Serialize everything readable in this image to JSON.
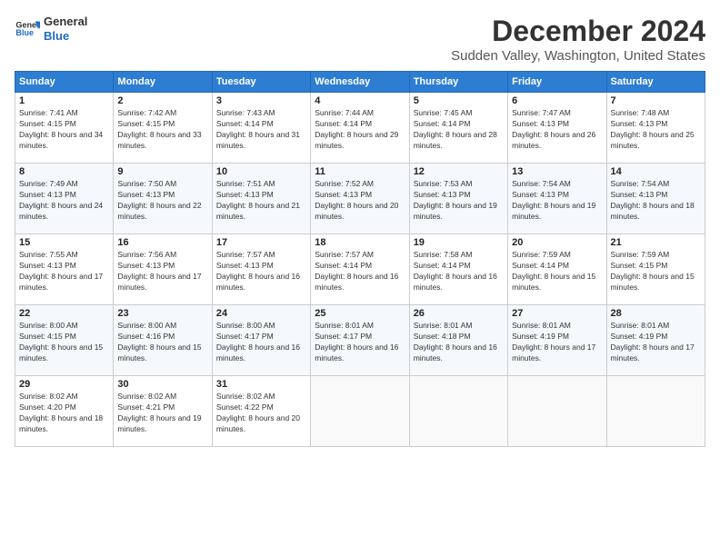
{
  "header": {
    "logo_line1": "General",
    "logo_line2": "Blue",
    "month": "December 2024",
    "location": "Sudden Valley, Washington, United States"
  },
  "weekdays": [
    "Sunday",
    "Monday",
    "Tuesday",
    "Wednesday",
    "Thursday",
    "Friday",
    "Saturday"
  ],
  "weeks": [
    [
      {
        "day": "1",
        "sunrise": "7:41 AM",
        "sunset": "4:15 PM",
        "daylight": "8 hours and 34 minutes."
      },
      {
        "day": "2",
        "sunrise": "7:42 AM",
        "sunset": "4:15 PM",
        "daylight": "8 hours and 33 minutes."
      },
      {
        "day": "3",
        "sunrise": "7:43 AM",
        "sunset": "4:14 PM",
        "daylight": "8 hours and 31 minutes."
      },
      {
        "day": "4",
        "sunrise": "7:44 AM",
        "sunset": "4:14 PM",
        "daylight": "8 hours and 29 minutes."
      },
      {
        "day": "5",
        "sunrise": "7:45 AM",
        "sunset": "4:14 PM",
        "daylight": "8 hours and 28 minutes."
      },
      {
        "day": "6",
        "sunrise": "7:47 AM",
        "sunset": "4:13 PM",
        "daylight": "8 hours and 26 minutes."
      },
      {
        "day": "7",
        "sunrise": "7:48 AM",
        "sunset": "4:13 PM",
        "daylight": "8 hours and 25 minutes."
      }
    ],
    [
      {
        "day": "8",
        "sunrise": "7:49 AM",
        "sunset": "4:13 PM",
        "daylight": "8 hours and 24 minutes."
      },
      {
        "day": "9",
        "sunrise": "7:50 AM",
        "sunset": "4:13 PM",
        "daylight": "8 hours and 22 minutes."
      },
      {
        "day": "10",
        "sunrise": "7:51 AM",
        "sunset": "4:13 PM",
        "daylight": "8 hours and 21 minutes."
      },
      {
        "day": "11",
        "sunrise": "7:52 AM",
        "sunset": "4:13 PM",
        "daylight": "8 hours and 20 minutes."
      },
      {
        "day": "12",
        "sunrise": "7:53 AM",
        "sunset": "4:13 PM",
        "daylight": "8 hours and 19 minutes."
      },
      {
        "day": "13",
        "sunrise": "7:54 AM",
        "sunset": "4:13 PM",
        "daylight": "8 hours and 19 minutes."
      },
      {
        "day": "14",
        "sunrise": "7:54 AM",
        "sunset": "4:13 PM",
        "daylight": "8 hours and 18 minutes."
      }
    ],
    [
      {
        "day": "15",
        "sunrise": "7:55 AM",
        "sunset": "4:13 PM",
        "daylight": "8 hours and 17 minutes."
      },
      {
        "day": "16",
        "sunrise": "7:56 AM",
        "sunset": "4:13 PM",
        "daylight": "8 hours and 17 minutes."
      },
      {
        "day": "17",
        "sunrise": "7:57 AM",
        "sunset": "4:13 PM",
        "daylight": "8 hours and 16 minutes."
      },
      {
        "day": "18",
        "sunrise": "7:57 AM",
        "sunset": "4:14 PM",
        "daylight": "8 hours and 16 minutes."
      },
      {
        "day": "19",
        "sunrise": "7:58 AM",
        "sunset": "4:14 PM",
        "daylight": "8 hours and 16 minutes."
      },
      {
        "day": "20",
        "sunrise": "7:59 AM",
        "sunset": "4:14 PM",
        "daylight": "8 hours and 15 minutes."
      },
      {
        "day": "21",
        "sunrise": "7:59 AM",
        "sunset": "4:15 PM",
        "daylight": "8 hours and 15 minutes."
      }
    ],
    [
      {
        "day": "22",
        "sunrise": "8:00 AM",
        "sunset": "4:15 PM",
        "daylight": "8 hours and 15 minutes."
      },
      {
        "day": "23",
        "sunrise": "8:00 AM",
        "sunset": "4:16 PM",
        "daylight": "8 hours and 15 minutes."
      },
      {
        "day": "24",
        "sunrise": "8:00 AM",
        "sunset": "4:17 PM",
        "daylight": "8 hours and 16 minutes."
      },
      {
        "day": "25",
        "sunrise": "8:01 AM",
        "sunset": "4:17 PM",
        "daylight": "8 hours and 16 minutes."
      },
      {
        "day": "26",
        "sunrise": "8:01 AM",
        "sunset": "4:18 PM",
        "daylight": "8 hours and 16 minutes."
      },
      {
        "day": "27",
        "sunrise": "8:01 AM",
        "sunset": "4:19 PM",
        "daylight": "8 hours and 17 minutes."
      },
      {
        "day": "28",
        "sunrise": "8:01 AM",
        "sunset": "4:19 PM",
        "daylight": "8 hours and 17 minutes."
      }
    ],
    [
      {
        "day": "29",
        "sunrise": "8:02 AM",
        "sunset": "4:20 PM",
        "daylight": "8 hours and 18 minutes."
      },
      {
        "day": "30",
        "sunrise": "8:02 AM",
        "sunset": "4:21 PM",
        "daylight": "8 hours and 19 minutes."
      },
      {
        "day": "31",
        "sunrise": "8:02 AM",
        "sunset": "4:22 PM",
        "daylight": "8 hours and 20 minutes."
      },
      null,
      null,
      null,
      null
    ]
  ]
}
